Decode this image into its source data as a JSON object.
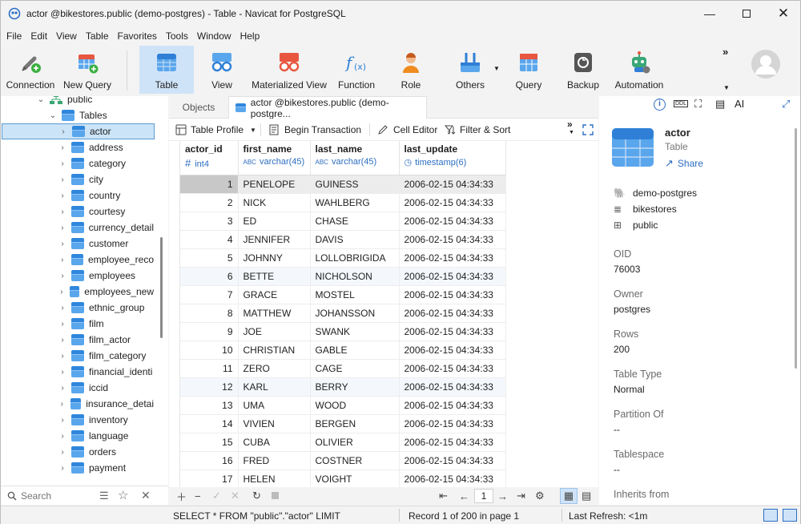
{
  "window": {
    "title": "actor @bikestores.public (demo-postgres) - Table - Navicat for PostgreSQL"
  },
  "menu": [
    "File",
    "Edit",
    "View",
    "Table",
    "Favorites",
    "Tools",
    "Window",
    "Help"
  ],
  "toolbar": {
    "connection": "Connection",
    "new_query": "New Query",
    "table": "Table",
    "view": "View",
    "materialized_view": "Materialized View",
    "function": "Function",
    "role": "Role",
    "others": "Others",
    "query": "Query",
    "backup": "Backup",
    "automation": "Automation",
    "accent": "#cfe3f8"
  },
  "tree": {
    "schema": "public",
    "group": "Tables",
    "items": [
      "actor",
      "address",
      "category",
      "city",
      "country",
      "courtesy",
      "currency_detail",
      "customer",
      "employee_reco",
      "employees",
      "employees_new",
      "ethnic_group",
      "film",
      "film_actor",
      "film_category",
      "financial_identi",
      "iccid",
      "insurance_detai",
      "inventory",
      "language",
      "orders",
      "payment"
    ],
    "selected": "actor",
    "search_placeholder": "Search"
  },
  "tabs": {
    "objects": "Objects",
    "active": "actor @bikestores.public (demo-postgre..."
  },
  "object_toolbar": {
    "table_profile": "Table Profile",
    "begin_transaction": "Begin Transaction",
    "cell_editor": "Cell Editor",
    "filter_sort": "Filter & Sort"
  },
  "grid": {
    "columns": [
      {
        "name": "actor_id",
        "type": "int4"
      },
      {
        "name": "first_name",
        "type": "varchar(45)"
      },
      {
        "name": "last_name",
        "type": "varchar(45)"
      },
      {
        "name": "last_update",
        "type": "timestamp(6)"
      }
    ],
    "rows": [
      [
        "1",
        "PENELOPE",
        "GUINESS",
        "2006-02-15 04:34:33"
      ],
      [
        "2",
        "NICK",
        "WAHLBERG",
        "2006-02-15 04:34:33"
      ],
      [
        "3",
        "ED",
        "CHASE",
        "2006-02-15 04:34:33"
      ],
      [
        "4",
        "JENNIFER",
        "DAVIS",
        "2006-02-15 04:34:33"
      ],
      [
        "5",
        "JOHNNY",
        "LOLLOBRIGIDA",
        "2006-02-15 04:34:33"
      ],
      [
        "6",
        "BETTE",
        "NICHOLSON",
        "2006-02-15 04:34:33"
      ],
      [
        "7",
        "GRACE",
        "MOSTEL",
        "2006-02-15 04:34:33"
      ],
      [
        "8",
        "MATTHEW",
        "JOHANSSON",
        "2006-02-15 04:34:33"
      ],
      [
        "9",
        "JOE",
        "SWANK",
        "2006-02-15 04:34:33"
      ],
      [
        "10",
        "CHRISTIAN",
        "GABLE",
        "2006-02-15 04:34:33"
      ],
      [
        "11",
        "ZERO",
        "CAGE",
        "2006-02-15 04:34:33"
      ],
      [
        "12",
        "KARL",
        "BERRY",
        "2006-02-15 04:34:33"
      ],
      [
        "13",
        "UMA",
        "WOOD",
        "2006-02-15 04:34:33"
      ],
      [
        "14",
        "VIVIEN",
        "BERGEN",
        "2006-02-15 04:34:33"
      ],
      [
        "15",
        "CUBA",
        "OLIVIER",
        "2006-02-15 04:34:33"
      ],
      [
        "16",
        "FRED",
        "COSTNER",
        "2006-02-15 04:34:33"
      ],
      [
        "17",
        "HELEN",
        "VOIGHT",
        "2006-02-15 04:34:33"
      ]
    ],
    "page": "1"
  },
  "info": {
    "name": "actor",
    "kind": "Table",
    "share": "Share",
    "connection": "demo-postgres",
    "database": "bikestores",
    "schema": "public",
    "props": [
      {
        "k": "OID",
        "v": "76003"
      },
      {
        "k": "Owner",
        "v": "postgres"
      },
      {
        "k": "Rows",
        "v": "200"
      },
      {
        "k": "Table Type",
        "v": "Normal"
      },
      {
        "k": "Partition Of",
        "v": "--"
      },
      {
        "k": "Tablespace",
        "v": "--"
      },
      {
        "k": "Inherits from",
        "v": ""
      }
    ]
  },
  "status": {
    "sql": "SELECT * FROM \"public\".\"actor\" LIMIT",
    "record": "Record 1 of 200 in page 1",
    "refresh": "Last Refresh: <1m"
  }
}
